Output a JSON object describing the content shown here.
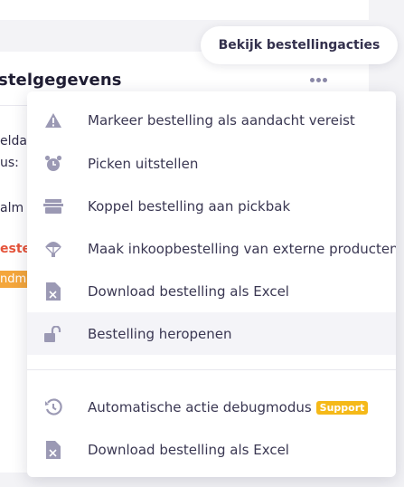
{
  "colors": {
    "accent": "#f5b918",
    "warning_text": "#e5533a",
    "orange_badge": "#f4a63b",
    "icon_gray": "#9b99b4"
  },
  "card": {
    "title": "stelgegevens",
    "fragments": [
      "elda",
      "us:",
      "alm",
      "este",
      "ndm"
    ]
  },
  "tooltip": {
    "label": "Bekijk bestellingacties"
  },
  "menu": {
    "items": [
      {
        "label": "Markeer bestelling als aandacht vereist",
        "icon": "warning-icon"
      },
      {
        "label": "Picken uitstellen",
        "icon": "alarm-clock-icon"
      },
      {
        "label": "Koppel bestelling aan pickbak",
        "icon": "bin-icon"
      },
      {
        "label": "Maak inkoopbestelling van externe producten",
        "icon": "parachute-icon"
      },
      {
        "label": "Download bestelling als Excel",
        "icon": "excel-file-icon"
      },
      {
        "label": "Bestelling heropenen",
        "icon": "unlock-icon"
      }
    ],
    "bottom_items": [
      {
        "label": "Automatische actie debugmodus",
        "icon": "history-icon",
        "badge": "Support"
      },
      {
        "label": "Download bestelling als Excel",
        "icon": "excel-file-icon"
      }
    ]
  }
}
